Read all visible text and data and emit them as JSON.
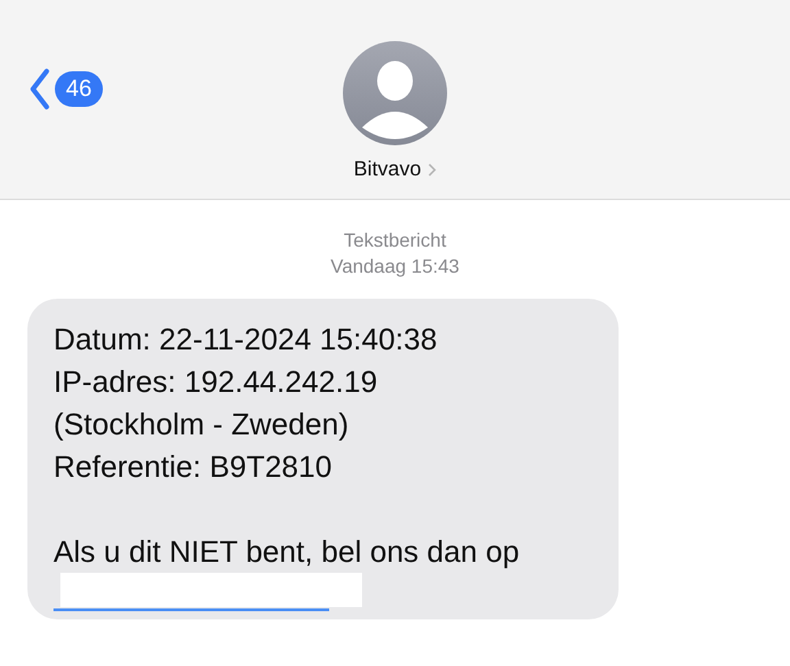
{
  "header": {
    "back_count": "46",
    "contact_name": "Bitvavo"
  },
  "timestamp": {
    "label": "Tekstbericht",
    "time": "Vandaag 15:43"
  },
  "message": {
    "lines": [
      "Datum: 22-11-2024 15:40:38",
      "IP-adres: 192.44.242.19",
      "(Stockholm - Zweden)",
      "Referentie: B9T2810"
    ],
    "closing": "Als u dit NIET bent, bel ons dan op"
  }
}
